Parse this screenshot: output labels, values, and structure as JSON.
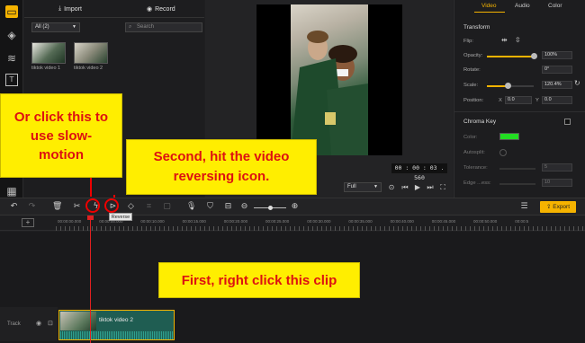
{
  "media_panel": {
    "import_label": "Import",
    "record_label": "Record",
    "filter_value": "All (2)",
    "search_placeholder": "Search",
    "items": [
      {
        "label": "tiktok video 1"
      },
      {
        "label": "tiktok video 2"
      }
    ]
  },
  "preview": {
    "timecode": "00 : 00 : 03 . 560",
    "quality": "Full"
  },
  "properties": {
    "tabs": [
      "Video",
      "Audio",
      "Color"
    ],
    "active_tab": "Video",
    "transform_heading": "Transform",
    "flip_label": "Flip:",
    "opacity_label": "Opacity:",
    "opacity_value": "100%",
    "opacity_level": 1.0,
    "rotate_label": "Rotate:",
    "rotate_value": "0°",
    "scale_label": "Scale:",
    "scale_value": "120.4%",
    "scale_level": 0.45,
    "position_label": "Position:",
    "position_x_label": "X",
    "position_x_value": "0.0",
    "position_y_label": "Y",
    "position_y_value": "0.0",
    "chroma_heading": "Chroma Key",
    "color_label": "Color:",
    "color_value": "#22dd22",
    "autosplit_label": "Autosplit:",
    "tolerance_label": "Tolerance:",
    "tolerance_value": "5",
    "edge_label": "Edge ...ess:",
    "edge_value": "10"
  },
  "toolbar": {
    "export_label": "Export",
    "tooltip": "Reverse",
    "accent": "#f5b300"
  },
  "timeline": {
    "ruler_labels": [
      "00:00:00.000",
      "00:00:05.000",
      "00:00:10.000",
      "00:00:15.000",
      "00:00:20.000",
      "00:00:25.000",
      "00:00:30.000",
      "00:00:35.000",
      "00:00:40.000",
      "00:00:45.000",
      "00:00:50.000",
      "00:00:5"
    ],
    "track_label": "Track",
    "clip_name": "tiktok video 2"
  },
  "annotations": {
    "note1": "Or click this to use slow-motion",
    "note2": "Second, hit the video reversing icon.",
    "note3": "First, right click this clip"
  }
}
